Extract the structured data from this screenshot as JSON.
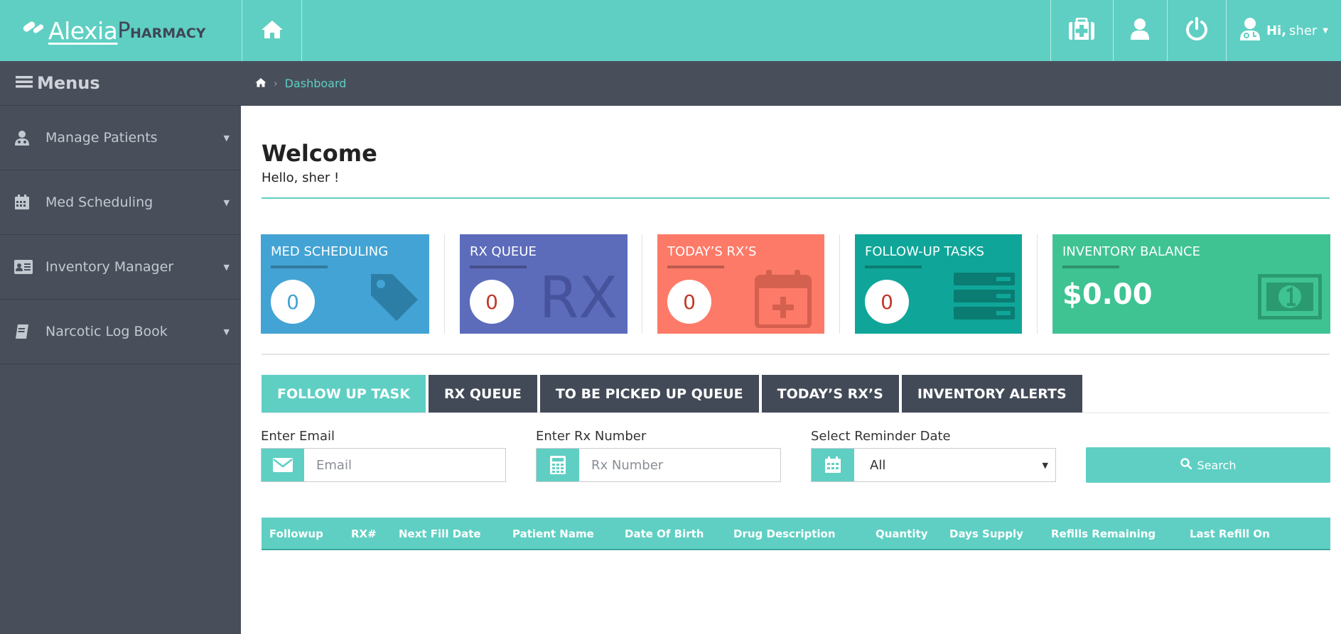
{
  "brand": {
    "name_part1": "Alexia",
    "name_part2_big": "P",
    "name_part2_small": "HARMACY"
  },
  "header": {
    "user_greeting": "Hi,",
    "user_name": "sher"
  },
  "sidebar": {
    "title": "Menus",
    "items": [
      {
        "label": "Manage Patients",
        "icon": "user-md-icon"
      },
      {
        "label": "Med Scheduling",
        "icon": "calendar-icon"
      },
      {
        "label": "Inventory Manager",
        "icon": "id-card-icon"
      },
      {
        "label": "Narcotic Log Book",
        "icon": "book-icon"
      }
    ]
  },
  "breadcrumb": {
    "current": "Dashboard"
  },
  "welcome": {
    "title": "Welcome",
    "subtitle": "Hello, sher !"
  },
  "cards": [
    {
      "title": "MED SCHEDULING",
      "value": "0",
      "color": "#43a3d4"
    },
    {
      "title": "RX QUEUE",
      "value": "0",
      "color": "#5c6bba"
    },
    {
      "title": "TODAY’S RX’S",
      "value": "0",
      "color": "#fd7a68"
    },
    {
      "title": "FOLLOW-UP TASKS",
      "value": "0",
      "color": "#0fa699"
    },
    {
      "title": "INVENTORY BALANCE",
      "value": "$0.00",
      "color": "#3fc393"
    }
  ],
  "tabs": [
    "FOLLOW UP TASK",
    "RX QUEUE",
    "TO BE PICKED UP QUEUE",
    "TODAY’S RX’S",
    "INVENTORY ALERTS"
  ],
  "filters": {
    "email_label": "Enter Email",
    "email_placeholder": "Email",
    "rx_label": "Enter Rx Number",
    "rx_placeholder": "Rx Number",
    "date_label": "Select Reminder Date",
    "date_value": "All",
    "search_label": "Search"
  },
  "table": {
    "columns": [
      "Followup",
      "RX#",
      "Next Fill Date",
      "Patient Name",
      "Date Of Birth",
      "Drug Description",
      "Quantity",
      "Days Supply",
      "Refills Remaining",
      "Last Refill On"
    ]
  },
  "colors": {
    "teal": "#5fcfc3",
    "sidebar": "#484f5b",
    "tab_dark": "#434a57"
  }
}
